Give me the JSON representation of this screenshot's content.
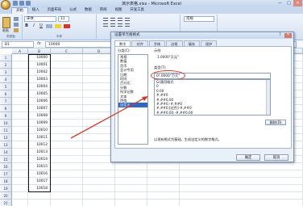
{
  "window": {
    "title": "演示表格.xlsx - Microsoft Excel",
    "min": "—",
    "max": "□",
    "close": "✕"
  },
  "tabs": [
    "开始",
    "插入",
    "页面布局",
    "公式",
    "数据",
    "审阅",
    "视图",
    "开发工具"
  ],
  "ribbon": {
    "paste_label": "粘贴",
    "clipboard_group": "剪贴板",
    "font_name": "宋体",
    "font_size": "11",
    "font_group": "字体",
    "align_group": "对齐方式",
    "number_format": "常规",
    "number_group": "数字",
    "bold": "B",
    "italic": "I",
    "underline": "U"
  },
  "formula_bar": {
    "name_box": "B1",
    "fx": "fx",
    "value": "10000"
  },
  "sheet": {
    "columns": [
      "A",
      "B",
      "C",
      "D",
      "E",
      "F",
      "G"
    ],
    "rows": [
      "1",
      "2",
      "3",
      "4",
      "5",
      "6",
      "7",
      "8",
      "9",
      "10",
      "11",
      "12",
      "13",
      "14",
      "15",
      "16",
      "17",
      "18",
      "19",
      "20",
      "21"
    ],
    "values": [
      "10000",
      "10001",
      "10002",
      "10003",
      "10004",
      "10005",
      "10006",
      "10007",
      "10008",
      "10009",
      "10010",
      "10011",
      "10012",
      "10013",
      "10014",
      "10015",
      "10016",
      "10017",
      "10018"
    ]
  },
  "dialog": {
    "title": "设置单元格格式",
    "help": "?",
    "close": "✕",
    "tabs": [
      "数字",
      "对齐",
      "字体",
      "边框",
      "填充",
      "保护"
    ],
    "category_label": "分类(C):",
    "categories": [
      "常规",
      "数值",
      "货币",
      "会计专用",
      "日期",
      "时间",
      "百分比",
      "分数",
      "科学记数",
      "文本",
      "特殊",
      "自定义"
    ],
    "selected_category_index": 11,
    "sample_label": "示例",
    "sample_value": "1.0000\"万元\"",
    "type_label": "类型(T):",
    "type_value": "0!.0000\"万元\"",
    "type_list": [
      "G/通用格式",
      "0",
      "0.00",
      "#,##0",
      "#,##0.00",
      "#,##0;-#,##0",
      "#,##0;[红色]-#,##0",
      "#,##0.00;-#,##0.00",
      "#,##0.00;[红色]-#,##0.00"
    ],
    "delete_button": "删除(D)",
    "description": "以现有格式为基础，生成自定义的数字格式。",
    "ok": "确定",
    "cancel": "取消"
  }
}
